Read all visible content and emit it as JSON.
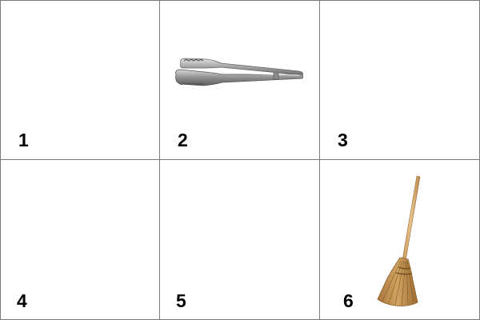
{
  "cells": [
    {
      "number": "1",
      "item": null
    },
    {
      "number": "2",
      "item": "tongs-icon"
    },
    {
      "number": "3",
      "item": null
    },
    {
      "number": "4",
      "item": null
    },
    {
      "number": "5",
      "item": null
    },
    {
      "number": "6",
      "item": "broom-icon"
    }
  ],
  "colors": {
    "grid_line": "#7a7a7a",
    "number_text": "#000000",
    "background": "#ffffff"
  }
}
